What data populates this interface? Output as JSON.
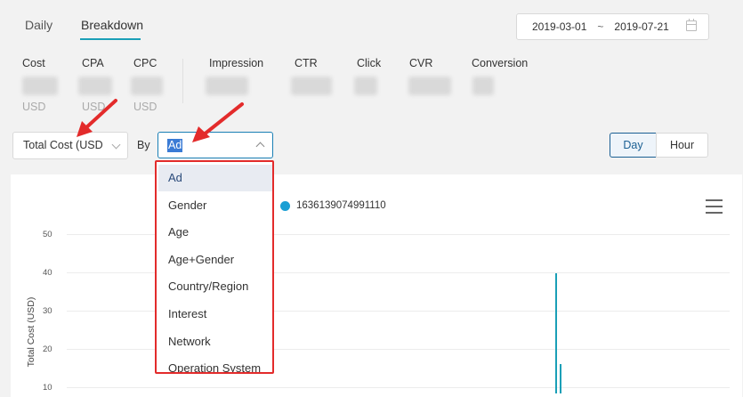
{
  "tabs": [
    {
      "label": "Daily"
    },
    {
      "label": "Breakdown"
    }
  ],
  "date_range": {
    "start": "2019-03-01",
    "separator": "~",
    "end": "2019-07-21"
  },
  "metrics": [
    {
      "label": "Cost",
      "unit": "USD"
    },
    {
      "label": "CPA",
      "unit": "USD"
    },
    {
      "label": "CPC",
      "unit": "USD"
    },
    {
      "label": "Impression"
    },
    {
      "label": "CTR"
    },
    {
      "label": "Click"
    },
    {
      "label": "CVR"
    },
    {
      "label": "Conversion"
    }
  ],
  "controls": {
    "metric_select": "Total Cost (USD",
    "by_label": "By",
    "by_select": "Ad",
    "granularity": {
      "day": "Day",
      "hour": "Hour",
      "active": "Day"
    }
  },
  "dropdown": {
    "options": [
      "Ad",
      "Gender",
      "Age",
      "Age+Gender",
      "Country/Region",
      "Interest",
      "Network",
      "Operation System"
    ],
    "selected": "Ad"
  },
  "chart": {
    "legend": "1636139074991110",
    "y_ticks": [
      "50",
      "40",
      "30",
      "20",
      "10"
    ],
    "ylabel": "Total Cost (USD)"
  },
  "chart_data": {
    "type": "line",
    "ylabel": "Total Cost (USD)",
    "ylim": [
      0,
      50
    ],
    "series": [
      {
        "name": "1636139074991110",
        "peaks": [
          40,
          16
        ]
      }
    ]
  },
  "colors": {
    "accent": "#1a9fb7",
    "highlight": "#e32b2b",
    "series": "#1a9fd4"
  }
}
